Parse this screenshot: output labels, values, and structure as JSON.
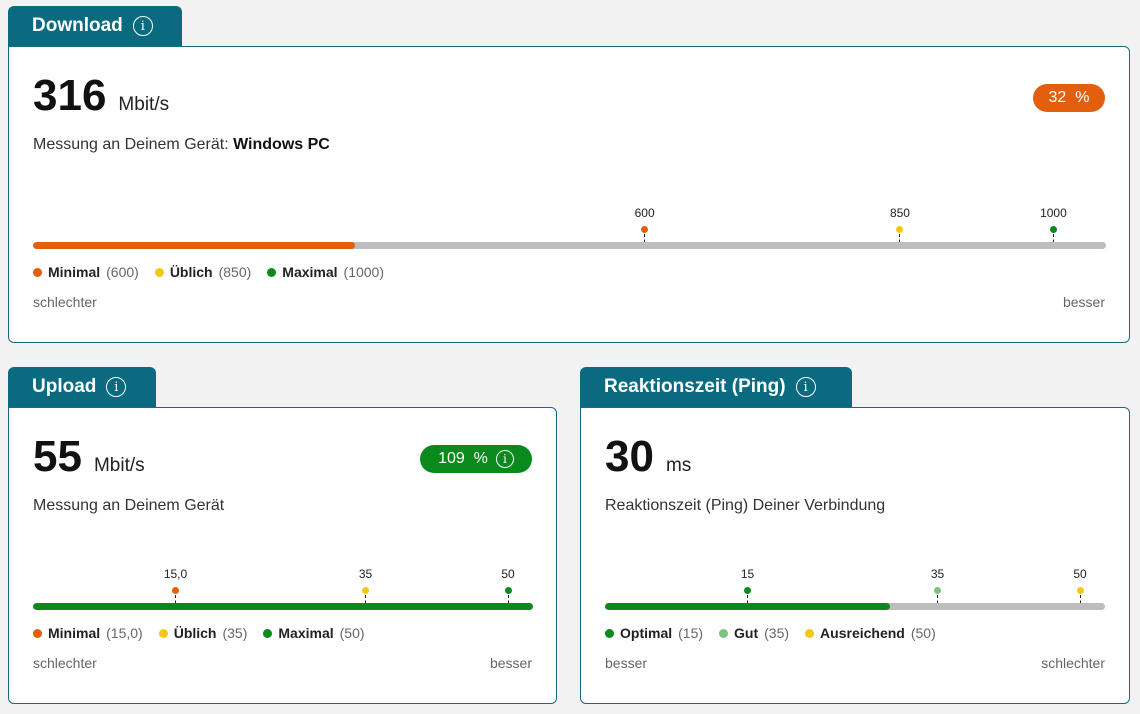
{
  "colors": {
    "teal": "#0a6b80",
    "orange": "#e35f0e",
    "yellow": "#f5c518",
    "green": "#0a8a1c",
    "lightgreen": "#7cc57e",
    "gray": "#bdbdbd"
  },
  "download": {
    "title": "Download",
    "value": "316",
    "unit": "Mbit/s",
    "subtitle_prefix": "Messung an Deinem Gerät: ",
    "device": "Windows PC",
    "badge": "32  %",
    "progress": 0.3,
    "markers": [
      {
        "label": "600",
        "pos": 0.57,
        "color": "#e35f0e"
      },
      {
        "label": "850",
        "pos": 0.808,
        "color": "#f5c518"
      },
      {
        "label": "1000",
        "pos": 0.951,
        "color": "#0a8a1c"
      }
    ],
    "legend": [
      {
        "name": "Minimal",
        "val": "(600)",
        "color": "#e35f0e"
      },
      {
        "name": "Üblich",
        "val": "(850)",
        "color": "#f5c518"
      },
      {
        "name": "Maximal",
        "val": "(1000)",
        "color": "#0a8a1c"
      }
    ],
    "left_label": "schlechter",
    "right_label": "besser"
  },
  "upload": {
    "title": "Upload",
    "value": "55",
    "unit": "Mbit/s",
    "subtitle": "Messung an Deinem Gerät",
    "badge": "109  %",
    "progress": 1.0,
    "markers": [
      {
        "label": "15,0",
        "pos": 0.285,
        "color": "#e35f0e"
      },
      {
        "label": "35",
        "pos": 0.665,
        "color": "#f5c518"
      },
      {
        "label": "50",
        "pos": 0.95,
        "color": "#0a8a1c"
      }
    ],
    "legend": [
      {
        "name": "Minimal",
        "val": "(15,0)",
        "color": "#e35f0e"
      },
      {
        "name": "Üblich",
        "val": "(35)",
        "color": "#f5c518"
      },
      {
        "name": "Maximal",
        "val": "(50)",
        "color": "#0a8a1c"
      }
    ],
    "left_label": "schlechter",
    "right_label": "besser"
  },
  "ping": {
    "title": "Reaktionszeit (Ping)",
    "value": "30",
    "unit": "ms",
    "subtitle": "Reaktionszeit (Ping) Deiner Verbindung",
    "progress": 0.57,
    "markers": [
      {
        "label": "15",
        "pos": 0.285,
        "color": "#0a8a1c"
      },
      {
        "label": "35",
        "pos": 0.665,
        "color": "#7cc57e"
      },
      {
        "label": "50",
        "pos": 0.95,
        "color": "#f5c518"
      }
    ],
    "legend": [
      {
        "name": "Optimal",
        "val": "(15)",
        "color": "#0a8a1c"
      },
      {
        "name": "Gut",
        "val": "(35)",
        "color": "#7cc57e"
      },
      {
        "name": "Ausreichend",
        "val": "(50)",
        "color": "#f5c518"
      }
    ],
    "left_label": "besser",
    "right_label": "schlechter"
  }
}
